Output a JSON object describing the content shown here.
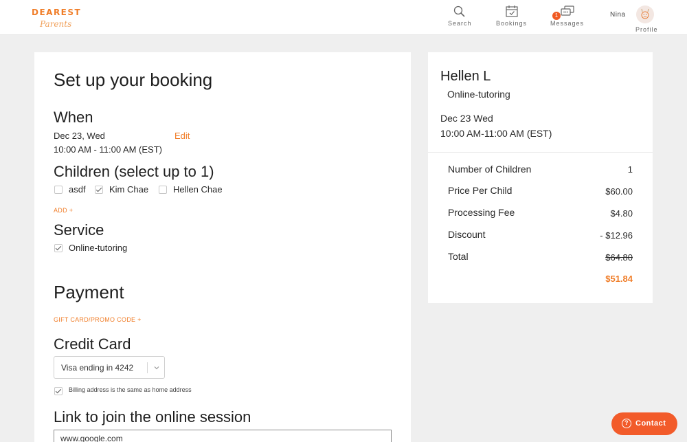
{
  "brand": {
    "logo_top": "DEAREST",
    "logo_bottom": "Parents",
    "accent": "#f07d28"
  },
  "nav": {
    "search": {
      "label": "Search",
      "icon": "search-icon"
    },
    "bookings": {
      "label": "Bookings",
      "icon": "calendar-icon"
    },
    "messages": {
      "label": "Messages",
      "icon": "chat-bubbles-icon",
      "badge": "1"
    },
    "user_name": "Nina",
    "profile": {
      "label": "Profile",
      "icon": "avatar"
    }
  },
  "booking": {
    "title": "Set up your booking",
    "when": {
      "heading": "When",
      "date": "Dec 23, Wed",
      "time": "10:00 AM - 11:00 AM (EST)",
      "edit_label": "Edit"
    },
    "children": {
      "heading": "Children (select up to 1)",
      "options": [
        {
          "label": "asdf",
          "checked": false
        },
        {
          "label": "Kim Chae",
          "checked": true
        },
        {
          "label": "Hellen Chae",
          "checked": false
        }
      ],
      "add_label": "ADD +"
    },
    "service": {
      "heading": "Service",
      "option": {
        "label": "Online-tutoring",
        "checked": true
      }
    },
    "payment": {
      "heading": "Payment",
      "promo_label": "GIFT CARD/PROMO CODE +",
      "credit_heading": "Credit Card",
      "card_value": "Visa ending in 4242",
      "billing_same_label": "Billing address is the same as home address",
      "billing_same_checked": true
    },
    "online": {
      "heading": "Link to join the online session",
      "link_value": "www.google.com"
    }
  },
  "summary": {
    "name": "Hellen L",
    "service": "Online-tutoring",
    "date": "Dec 23 Wed",
    "time": "10:00 AM-11:00 AM (EST)",
    "rows": [
      {
        "label": "Number of Children",
        "value": "1"
      },
      {
        "label": "Price Per Child",
        "value": "$60.00"
      },
      {
        "label": "Processing Fee",
        "value": "$4.80"
      },
      {
        "label": "Discount",
        "value": "- $12.96"
      },
      {
        "label": "Total",
        "value": "$64.80"
      }
    ],
    "final_total": "$51.84"
  },
  "contact": {
    "label": "Contact",
    "icon": "question-icon"
  }
}
